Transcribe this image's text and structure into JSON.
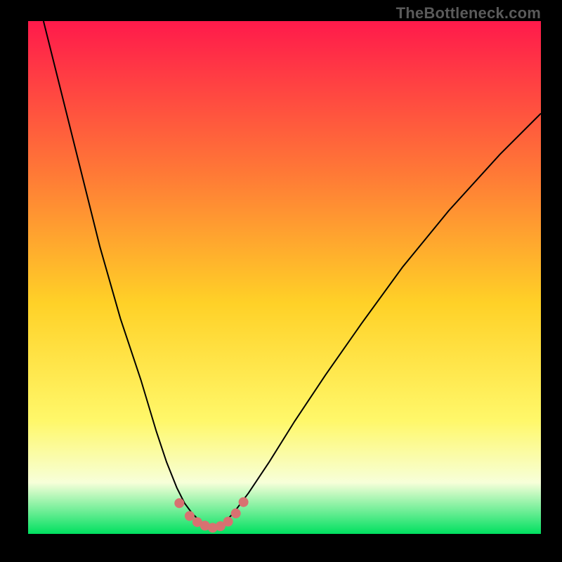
{
  "watermark": "TheBottleneck.com",
  "colors": {
    "frame": "#000000",
    "gradient_top": "#ff1a4b",
    "gradient_mid_upper": "#ff7a36",
    "gradient_mid": "#ffd127",
    "gradient_mid_lower": "#fff86a",
    "gradient_pale": "#f7ffd9",
    "gradient_bottom": "#00e060",
    "curve": "#000000",
    "marker": "#d87171"
  },
  "chart_data": {
    "type": "line",
    "title": "",
    "xlabel": "",
    "ylabel": "",
    "xlim": [
      0,
      100
    ],
    "ylim": [
      0,
      100
    ],
    "series": [
      {
        "name": "bottleneck-curve-left",
        "x": [
          3,
          6,
          10,
          14,
          18,
          22,
          25,
          27,
          29,
          30.5,
          32,
          33.5,
          35,
          36.5
        ],
        "values": [
          100,
          88,
          72,
          56,
          42,
          30,
          20,
          14,
          9,
          6,
          4,
          2.5,
          1.5,
          1
        ]
      },
      {
        "name": "bottleneck-curve-right",
        "x": [
          36.5,
          38,
          40,
          43,
          47,
          52,
          58,
          65,
          73,
          82,
          92,
          100
        ],
        "values": [
          1,
          2,
          4,
          8,
          14,
          22,
          31,
          41,
          52,
          63,
          74,
          82
        ]
      }
    ],
    "markers": {
      "name": "highlight-points",
      "x": [
        29.5,
        31.5,
        33,
        34.5,
        36,
        37.5,
        39,
        40.5,
        42
      ],
      "values": [
        6,
        3.5,
        2.3,
        1.6,
        1.2,
        1.5,
        2.4,
        4,
        6.2
      ],
      "radius_px": 7
    },
    "gradient_stops": [
      {
        "offset": 0.0,
        "color": "#ff1a4b"
      },
      {
        "offset": 0.3,
        "color": "#ff7a36"
      },
      {
        "offset": 0.55,
        "color": "#ffd127"
      },
      {
        "offset": 0.78,
        "color": "#fff86a"
      },
      {
        "offset": 0.9,
        "color": "#f7ffd9"
      },
      {
        "offset": 1.0,
        "color": "#00e060"
      }
    ]
  }
}
